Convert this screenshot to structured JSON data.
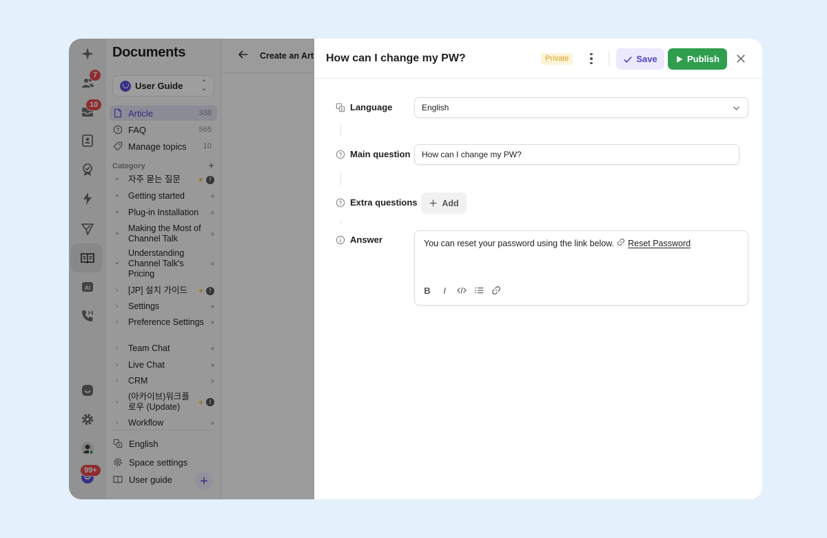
{
  "rail": {
    "badges": {
      "people": "7",
      "inbox": "10",
      "profile": "99+"
    }
  },
  "sidebar": {
    "title": "Documents",
    "space": "User Guide",
    "nav": [
      {
        "label": "Article",
        "count": "338",
        "icon": "article-icon"
      },
      {
        "label": "FAQ",
        "count": "565",
        "icon": "faq-icon"
      },
      {
        "label": "Manage topics",
        "count": "10",
        "icon": "tag-icon"
      }
    ],
    "category_header": "Category",
    "categories": [
      {
        "label": "자주 묻는 질문",
        "lead": "•",
        "status": "yellow",
        "warn": "!"
      },
      {
        "label": "Getting started",
        "lead": "•",
        "status": "grey"
      },
      {
        "label": "Plug-in Installation",
        "lead": "•",
        "status": "grey"
      },
      {
        "label": "Making the Most of Channel Talk",
        "lead": "•",
        "status": "grey"
      },
      {
        "label": "Understanding Channel Talk's Pricing",
        "lead": "•",
        "status": "grey"
      },
      {
        "label": "[JP] 설치 가이드",
        "lead": "›",
        "status": "yellow",
        "warn": "!"
      },
      {
        "label": "Settings",
        "lead": "›",
        "status": "grey"
      },
      {
        "label": "Preference Settings",
        "lead": "›",
        "status": "grey"
      },
      {
        "label": "Team Chat",
        "lead": "›",
        "status": "grey"
      },
      {
        "label": "Live Chat",
        "lead": "›",
        "status": "grey"
      },
      {
        "label": "CRM",
        "lead": "›",
        "status": "grey"
      },
      {
        "label": "(아카이브)워크플로우 (Update)",
        "lead": "›",
        "status": "yellow",
        "warn": "!"
      },
      {
        "label": "Workflow",
        "lead": "›",
        "status": "grey"
      }
    ],
    "footer": {
      "language": "English",
      "space_settings": "Space settings",
      "user_guide": "User guide"
    }
  },
  "background": {
    "back_icon": "arrow-left-icon",
    "title": "Create an Arti"
  },
  "panel": {
    "title": "How can I change my PW?",
    "private_badge": "Private",
    "save_label": "Save",
    "publish_label": "Publish",
    "fields": {
      "language_label": "Language",
      "language_value": "English",
      "main_question_label": "Main question",
      "main_question_value": "How can I change my PW?",
      "extra_questions_label": "Extra questions",
      "add_label": "Add",
      "answer_label": "Answer",
      "answer_text": "You can reset your password using the link below.",
      "answer_link": "Reset Password"
    }
  },
  "colors": {
    "accent": "#5b4fd8",
    "publish_green": "#2f9e4f",
    "badge_red": "#e5484d",
    "private_yellow": "#d6a02a"
  }
}
